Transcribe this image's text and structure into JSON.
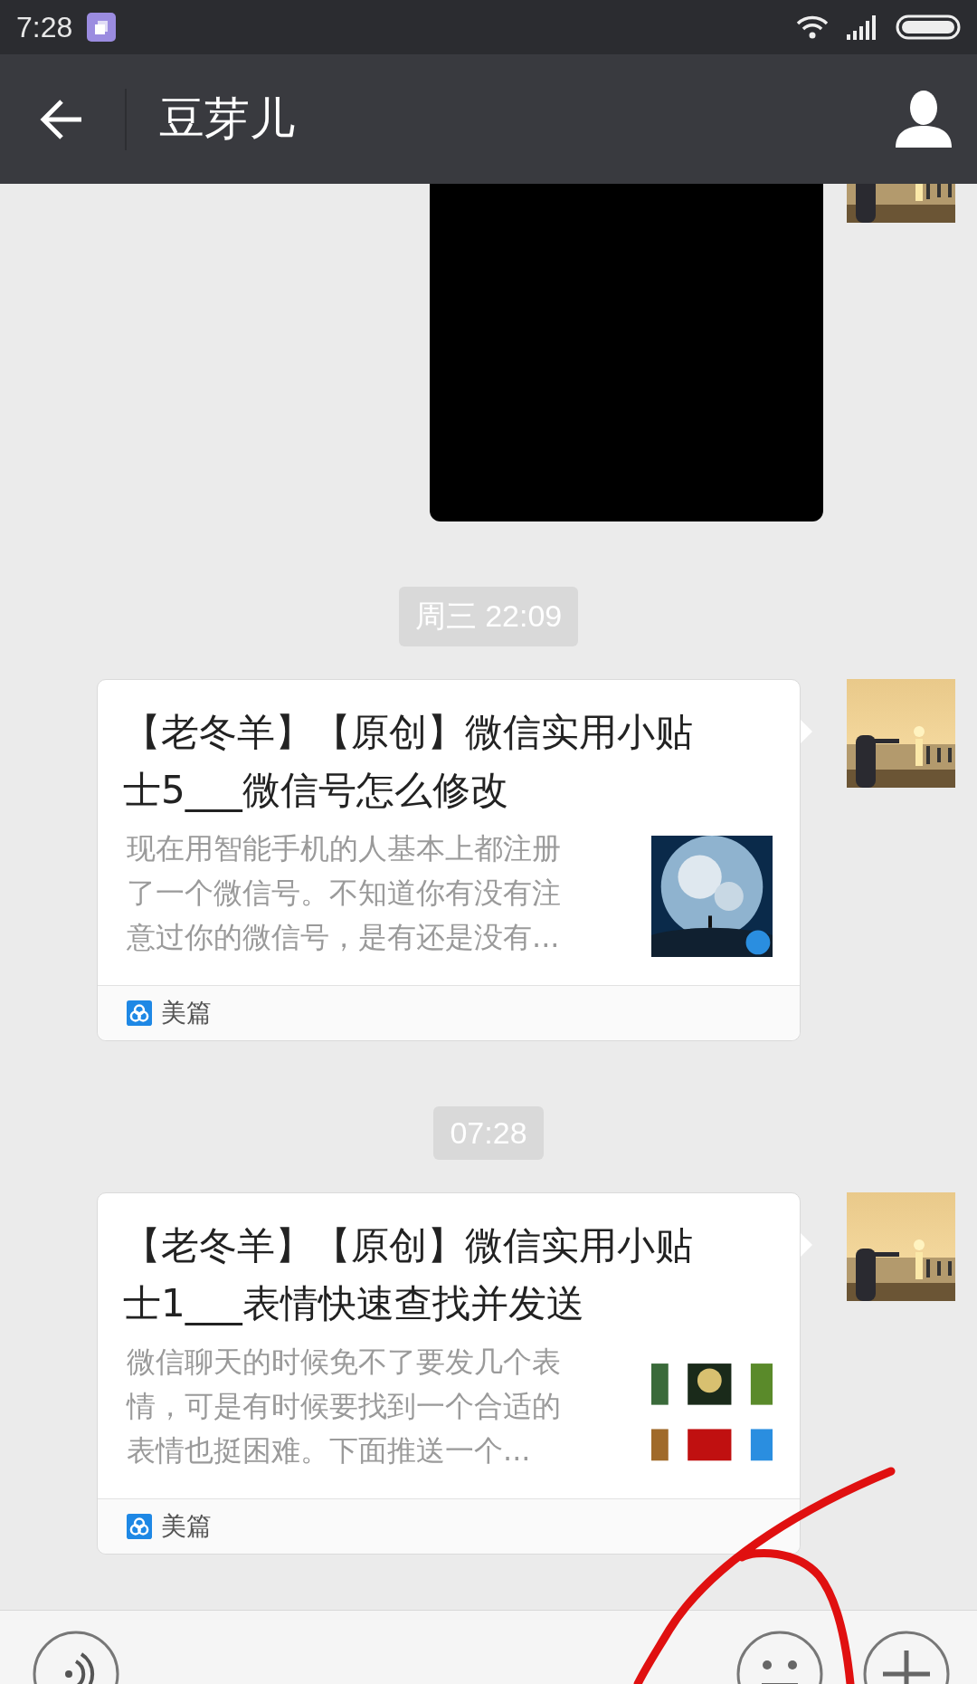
{
  "status_bar": {
    "time": "7:28"
  },
  "header": {
    "title": "豆芽儿"
  },
  "messages": [
    {
      "kind": "media"
    },
    {
      "kind": "timestamp",
      "text": "周三 22:09"
    },
    {
      "kind": "article",
      "title": "【老冬羊】【原创】微信实用小贴士5___微信号怎么修改",
      "description": "现在用智能手机的人基本上都注册了一个微信号。不知道你有没有注意过你的微信号，是有还是没有...",
      "source": "美篇"
    },
    {
      "kind": "timestamp",
      "text": "07:28"
    },
    {
      "kind": "article",
      "title": "【老冬羊】【原创】微信实用小贴士1___表情快速查找并发送",
      "description": "微信聊天的时候免不了要发几个表情，可是有时候要找到一个合适的表情也挺困难。下面推送一个...",
      "source": "美篇"
    }
  ],
  "annotation": {
    "kind": "freehand"
  }
}
